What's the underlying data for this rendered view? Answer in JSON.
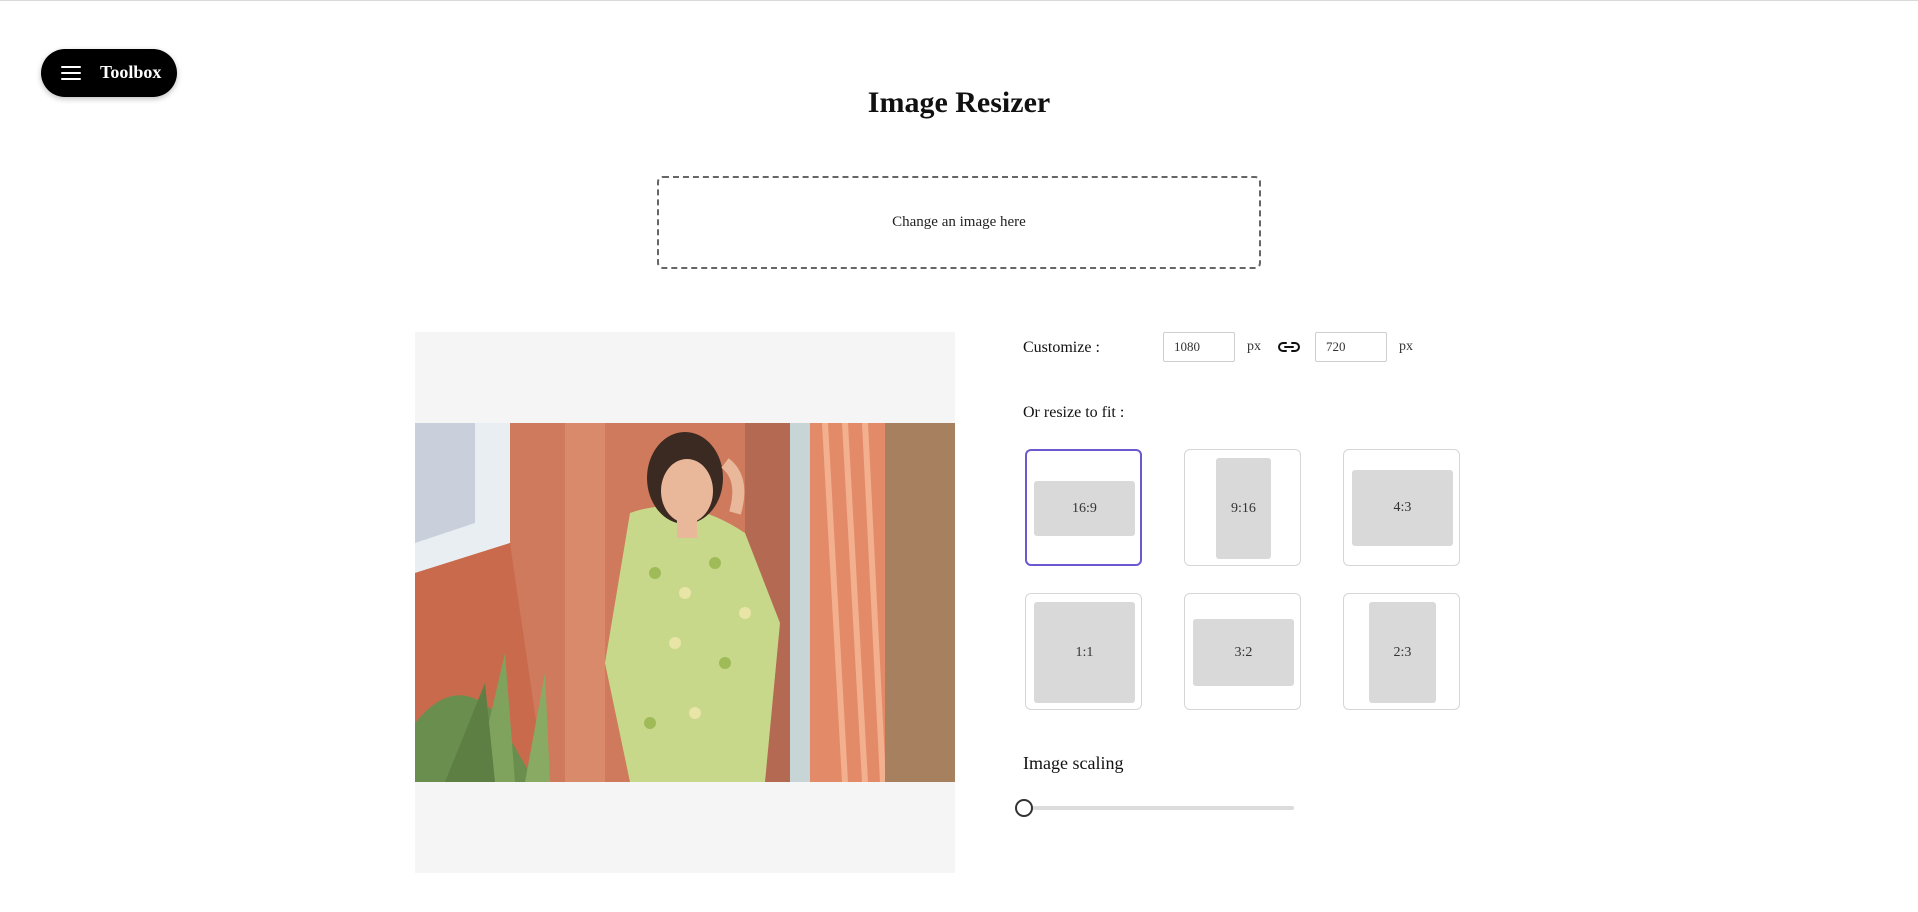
{
  "toolbox": {
    "label": "Toolbox"
  },
  "page": {
    "title": "Image Resizer"
  },
  "upload": {
    "prompt": "Change an image here"
  },
  "customize": {
    "label": "Customize :",
    "width": "1080",
    "height": "720",
    "unit": "px"
  },
  "resize_fit": {
    "label": "Or resize to fit :",
    "options": [
      "16:9",
      "9:16",
      "4:3",
      "1:1",
      "3:2",
      "2:3"
    ],
    "selected": "16:9"
  },
  "scaling": {
    "label": "Image scaling",
    "value": 0
  },
  "colors": {
    "accent": "#6a5acd",
    "button_bg": "#000000"
  }
}
